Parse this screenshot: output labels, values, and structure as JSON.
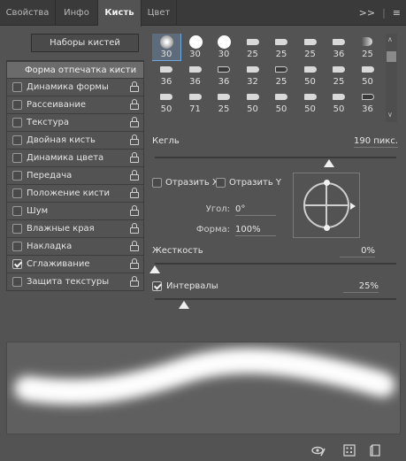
{
  "tabs": [
    {
      "label": "Свойства",
      "active": false
    },
    {
      "label": "Инфо",
      "active": false
    },
    {
      "label": "Кисть",
      "active": true
    },
    {
      "label": "Цвет",
      "active": false
    }
  ],
  "tabbar_icons": {
    "collapse": ">>",
    "menu": "≡"
  },
  "presets_button": "Наборы кистей",
  "left_panel": {
    "header": "Форма отпечатка кисти",
    "items": [
      {
        "label": "Динамика формы",
        "checked": false
      },
      {
        "label": "Рассеивание",
        "checked": false
      },
      {
        "label": "Текстура",
        "checked": false
      },
      {
        "label": "Двойная кисть",
        "checked": false
      },
      {
        "label": "Динамика цвета",
        "checked": false
      },
      {
        "label": "Передача",
        "checked": false
      },
      {
        "label": "Положение кисти",
        "checked": false
      },
      {
        "label": "Шум",
        "checked": false
      },
      {
        "label": "Влажные края",
        "checked": false
      },
      {
        "label": "Накладка",
        "checked": false
      },
      {
        "label": "Сглаживание",
        "checked": true
      },
      {
        "label": "Защита текстуры",
        "checked": false
      }
    ]
  },
  "brush_grid": {
    "selected_index": 0,
    "rows": [
      [
        {
          "size": "30",
          "kind": "soft"
        },
        {
          "size": "30",
          "kind": "hard"
        },
        {
          "size": "30",
          "kind": "hard"
        },
        {
          "size": "25",
          "kind": "tip"
        },
        {
          "size": "25",
          "kind": "tip"
        },
        {
          "size": "25",
          "kind": "tip"
        },
        {
          "size": "36",
          "kind": "tip"
        },
        {
          "size": "25",
          "kind": "fan"
        }
      ],
      [
        {
          "size": "36",
          "kind": "tip"
        },
        {
          "size": "36",
          "kind": "tip"
        },
        {
          "size": "36",
          "kind": "dark"
        },
        {
          "size": "32",
          "kind": "tip"
        },
        {
          "size": "25",
          "kind": "dark"
        },
        {
          "size": "50",
          "kind": "tip"
        },
        {
          "size": "25",
          "kind": "tip"
        },
        {
          "size": "50",
          "kind": "tip"
        }
      ],
      [
        {
          "size": "50",
          "kind": "tip"
        },
        {
          "size": "71",
          "kind": "tip"
        },
        {
          "size": "25",
          "kind": "tip"
        },
        {
          "size": "50",
          "kind": "tip"
        },
        {
          "size": "50",
          "kind": "tip"
        },
        {
          "size": "50",
          "kind": "tip"
        },
        {
          "size": "50",
          "kind": "tip"
        },
        {
          "size": "36",
          "kind": "dark"
        }
      ]
    ]
  },
  "size": {
    "label": "Кегль",
    "value": "190 пикс.",
    "slider_fraction": 0.72
  },
  "flip_x": {
    "label": "Отразить X",
    "checked": false
  },
  "flip_y": {
    "label": "Отразить Y",
    "checked": false
  },
  "angle": {
    "label": "Угол:",
    "value": "0°"
  },
  "roundness": {
    "label": "Форма:",
    "value": "100%"
  },
  "hardness": {
    "label": "Жесткость",
    "value": "0%",
    "slider_fraction": 0.0
  },
  "spacing": {
    "label": "Интервалы",
    "value": "25%",
    "checked": true,
    "slider_fraction": 0.12
  },
  "bottom_icons": [
    "eye-brush-icon",
    "grid-icon",
    "new-preset-icon"
  ]
}
